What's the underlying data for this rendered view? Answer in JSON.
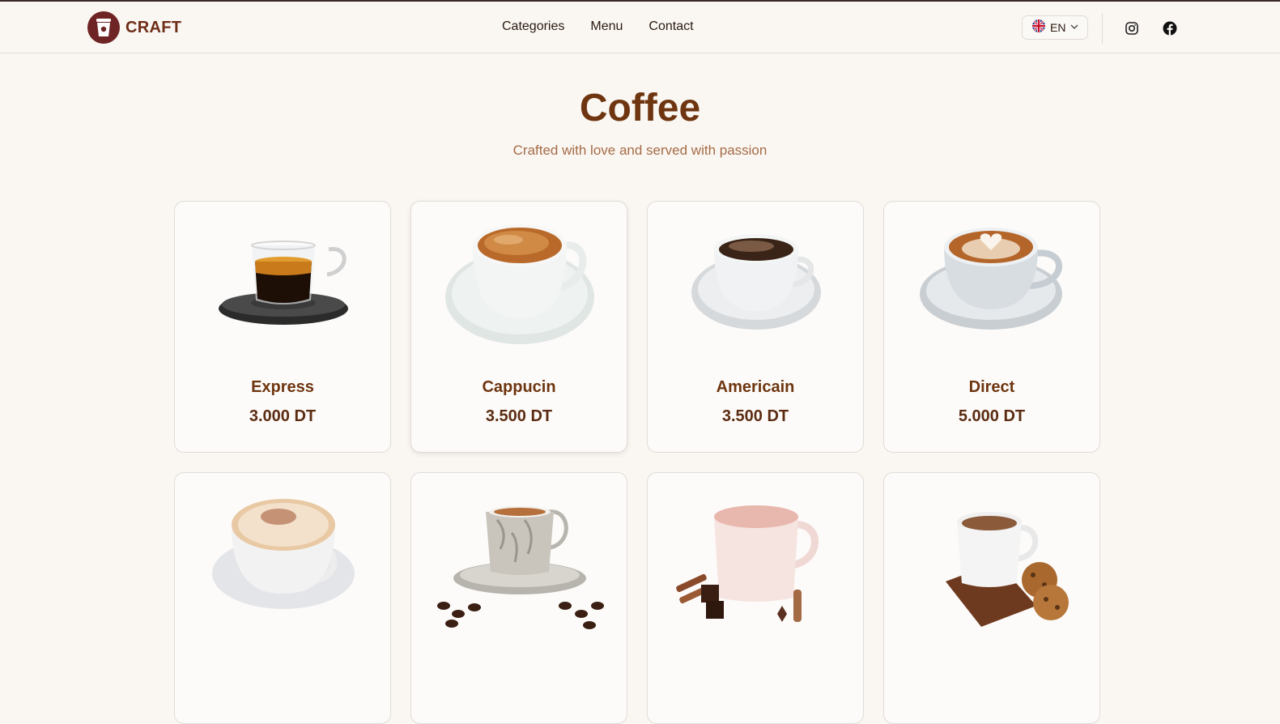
{
  "header": {
    "brand": "CRAFT",
    "nav": [
      {
        "label": "Categories"
      },
      {
        "label": "Menu"
      },
      {
        "label": "Contact"
      }
    ],
    "language": {
      "code": "EN",
      "flag_icon": "uk-flag-icon",
      "chevron_icon": "chevron-down-icon"
    },
    "social": [
      {
        "icon": "instagram-icon"
      },
      {
        "icon": "facebook-icon"
      }
    ]
  },
  "hero": {
    "title": "Coffee",
    "subtitle": "Crafted with love and served with passion"
  },
  "products": [
    {
      "name": "Express",
      "price": "3.000 DT",
      "image": "espresso-glass-cup"
    },
    {
      "name": "Cappucin",
      "price": "3.500 DT",
      "image": "cappuccino-cup"
    },
    {
      "name": "Americain",
      "price": "3.500 DT",
      "image": "americano-cup"
    },
    {
      "name": "Direct",
      "price": "5.000 DT",
      "image": "latte-art-cup"
    },
    {
      "name": "",
      "price": "",
      "image": "cappuccino-cocoa-cup"
    },
    {
      "name": "",
      "price": "",
      "image": "turkish-coffee-cup"
    },
    {
      "name": "",
      "price": "",
      "image": "chocolate-drink-cup"
    },
    {
      "name": "",
      "price": "",
      "image": "tea-with-cookies-cup"
    }
  ],
  "colors": {
    "accent": "#6e3510",
    "brand": "#6e2424",
    "subtitle": "#a56b45",
    "background": "#faf7f3"
  }
}
